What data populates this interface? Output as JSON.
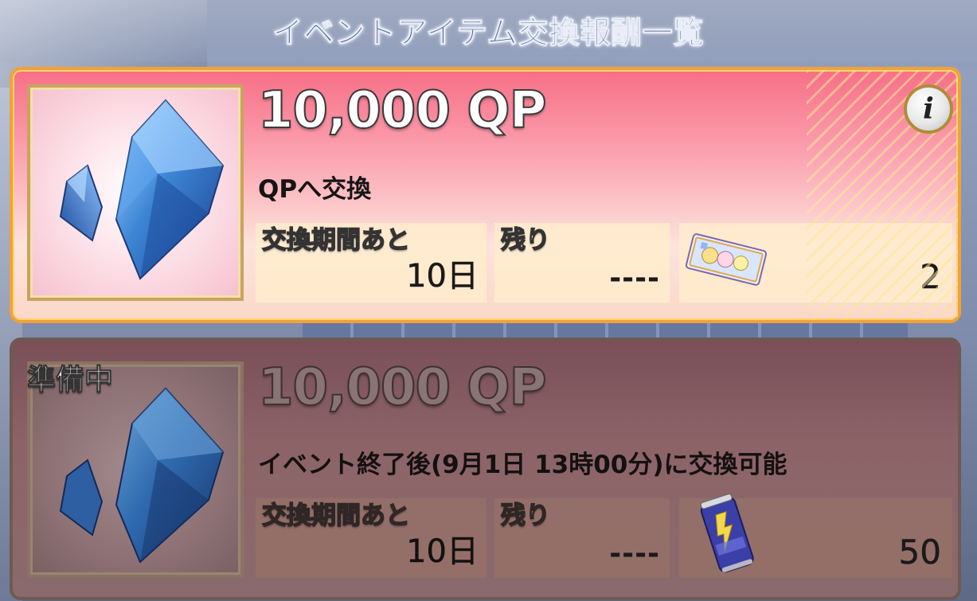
{
  "title": "イベントアイテム交換報酬一覧",
  "colors": {
    "active_card": "#fb9fae",
    "active_border": "#f0a23a",
    "inactive_card": "#8c6468",
    "title_text": "#4b5b8e"
  },
  "items": [
    {
      "status": "",
      "reward_icon": "qp-crystal-icon",
      "reward_name": "10,000 QP",
      "description": "QPへ交換",
      "info_icon": "i",
      "period_label": "交換期間あと",
      "period_value": "10日",
      "remaining_label": "残り",
      "remaining_value": "----",
      "cost_icon": "event-ticket-icon",
      "cost_value": "2"
    },
    {
      "status": "準備中",
      "reward_icon": "qp-crystal-icon",
      "reward_name": "10,000 QP",
      "description": "イベント終了後(9月1日 13時00分)に交換可能",
      "period_label": "交換期間あと",
      "period_value": "10日",
      "remaining_label": "残り",
      "remaining_value": "----",
      "cost_icon": "energy-drink-can-icon",
      "cost_value": "50"
    }
  ]
}
